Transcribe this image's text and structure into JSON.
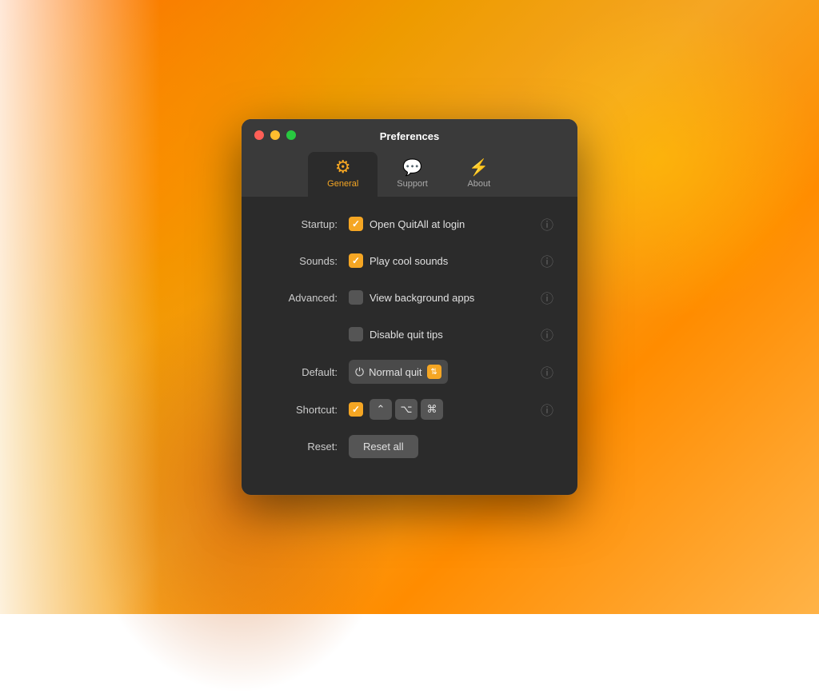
{
  "background": {
    "colors": [
      "#ff6a00",
      "#ee9b00",
      "#f5a623",
      "#ff8c00"
    ]
  },
  "window": {
    "title": "Preferences",
    "traffic_lights": {
      "close": "close",
      "minimize": "minimize",
      "maximize": "maximize"
    }
  },
  "tabs": [
    {
      "id": "general",
      "label": "General",
      "icon": "⚙",
      "active": true
    },
    {
      "id": "support",
      "label": "Support",
      "icon": "💬",
      "active": false
    },
    {
      "id": "about",
      "label": "About",
      "icon": "⚡",
      "active": false
    }
  ],
  "settings": {
    "startup": {
      "label": "Startup:",
      "checked": true,
      "text": "Open QuitAll at login"
    },
    "sounds": {
      "label": "Sounds:",
      "checked": true,
      "text": "Play cool sounds"
    },
    "advanced": {
      "label": "Advanced:",
      "rows": [
        {
          "checked": false,
          "text": "View background apps"
        },
        {
          "checked": false,
          "text": "Disable quit tips"
        }
      ]
    },
    "default": {
      "label": "Default:",
      "text": "Normal quit",
      "icon": "⏻"
    },
    "shortcut": {
      "label": "Shortcut:",
      "checked": true,
      "keys": [
        "⌃",
        "⌥",
        "⌘"
      ]
    },
    "reset": {
      "label": "Reset:",
      "button_label": "Reset all"
    }
  },
  "help_icon": "?",
  "icons": {
    "gear": "⚙",
    "support": "💬",
    "about": "⚡",
    "power": "⏻",
    "up_arrow": "↑",
    "option": "⌥",
    "command": "⌘",
    "control": "⌃"
  }
}
